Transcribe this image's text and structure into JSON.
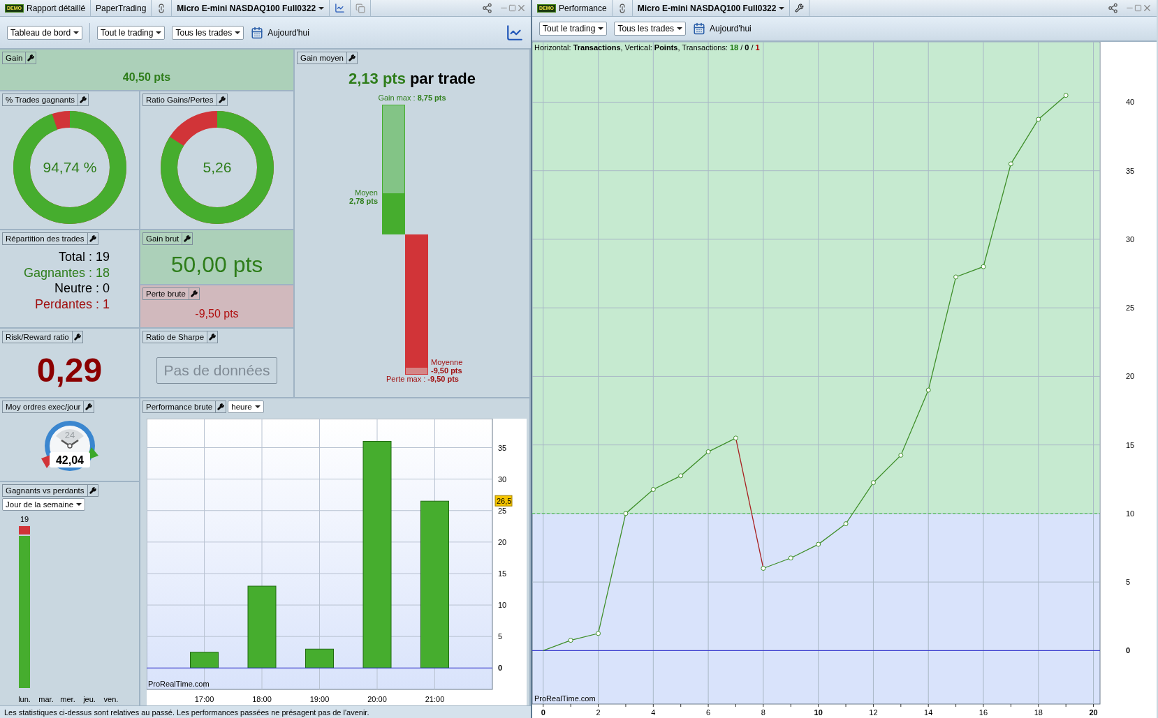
{
  "left_window": {
    "badge": "DEMO",
    "title_segments": [
      "Rapport détaillé",
      "PaperTrading"
    ],
    "instrument": "Micro E-mini NASDAQ100 Full0322",
    "toolbar": {
      "dropdowns": [
        "Tableau de bord",
        "Tout le trading",
        "Tous les trades"
      ],
      "date_button": "Aujourd'hui"
    },
    "gain": {
      "title": "Gain",
      "value": "40,50 pts"
    },
    "winning_trades": {
      "title": "% Trades gagnants",
      "reading": "94,74 %",
      "level": 0.9474
    },
    "gain_loss_ratio": {
      "title": "Ratio Gains/Pertes",
      "reading": "5,26",
      "level": 0.84
    },
    "average_gain": {
      "title": "Gain moyen",
      "value": "2,13 pts",
      "suffix": "par trade",
      "max_gain": "Gain max : **8,75 pts**",
      "average_label": "Moyen",
      "average_value": "2,78 pts",
      "average_loss_label": "Moyenne",
      "average_loss_value": "-9,50 pts",
      "max_loss": "Perte max : **-9,50 pts**"
    },
    "trade_breakdown": {
      "title": "Répartition des trades",
      "lines": [
        {
          "kind": "total",
          "text": "Total : 19"
        },
        {
          "kind": "win",
          "text": "Gagnantes : 18"
        },
        {
          "kind": "neutral",
          "text": "Neutre : 0"
        },
        {
          "kind": "loss",
          "text": "Perdantes : 1"
        }
      ]
    },
    "gross_gain": {
      "title": "Gain brut",
      "value": "50,00 pts"
    },
    "gross_loss": {
      "title": "Perte brute",
      "value": "-9,50 pts"
    },
    "risk_reward": {
      "title": "Risk/Reward ratio",
      "value": "0,29"
    },
    "sharpe": {
      "title": "Ratio de Sharpe",
      "message": "Pas de données"
    },
    "orders_per_day": {
      "title": "Moy ordres exec/jour",
      "dial_label": "24",
      "value": "42,04"
    },
    "winners_vs_losers": {
      "title": "Gagnants vs perdants",
      "period": "Jour de la semaine",
      "total_label": "19",
      "days": [
        "lun.",
        "mar.",
        "mer.",
        "jeu.",
        "ven."
      ]
    },
    "gross_performance": {
      "title": "Performance brute",
      "period": "heure",
      "watermark": "ProRealTime.com",
      "chart_data": {
        "type": "bar",
        "grid": true,
        "categories": [
          "17:00",
          "18:00",
          "19:00",
          "20:00",
          "21:00"
        ],
        "series": [
          {
            "color": "#46ad2e",
            "values": [
              2.5,
              13,
              3,
              36,
              26.5
            ]
          }
        ],
        "ylim": [
          -3.4,
          39.6
        ],
        "yticks": [
          0,
          5,
          10,
          15,
          20,
          25,
          30,
          35
        ],
        "ref_lines": [
          {
            "axis": "y",
            "value": 0,
            "color": "#2a2ad0"
          }
        ],
        "annotations": [
          "26,5"
        ]
      }
    },
    "status_bar": "Les statistiques ci-dessus sont relatives au passé. Les performances passées ne présagent pas de l'avenir."
  },
  "right_window": {
    "badge": "DEMO",
    "title": "Performance",
    "instrument": "Micro E-mini NASDAQ100 Full0322",
    "toolbar": {
      "dropdowns": [
        "Tout le trading",
        "Tous les trades"
      ],
      "date_button": "Aujourd'hui"
    },
    "chart": {
      "legend": "Horizontal: **Transactions**, Vertical: **Points**, Transactions:",
      "counts": [
        {
          "value": "18",
          "color": "#1e7a12"
        },
        {
          "value": "0",
          "color": "#000000"
        },
        {
          "value": "1",
          "color": "#b00000"
        }
      ],
      "separator": "/",
      "watermark": "ProRealTime.com",
      "chart_data": {
        "type": "line",
        "grid": true,
        "x": [
          0,
          1,
          2,
          3,
          4,
          5,
          6,
          7,
          8,
          9,
          10,
          11,
          12,
          13,
          14,
          15,
          16,
          17,
          18,
          19
        ],
        "series": [
          {
            "color": "#3f8f2a",
            "marker": true,
            "values": [
              0,
              0.75,
              1.25,
              10,
              11.75,
              12.75,
              14.5,
              15.5,
              null,
              null,
              null,
              null,
              null,
              null,
              null,
              null,
              null,
              null,
              null,
              null
            ]
          },
          {
            "color": "#a82020",
            "marker": false,
            "values": [
              null,
              null,
              null,
              null,
              null,
              null,
              null,
              15.5,
              6,
              null,
              null,
              null,
              null,
              null,
              null,
              null,
              null,
              null,
              null,
              null
            ]
          },
          {
            "color": "#3f8f2a",
            "marker": true,
            "values": [
              null,
              null,
              null,
              null,
              null,
              null,
              null,
              null,
              6,
              6.75,
              7.75,
              9.25,
              12.25,
              14.25,
              19,
              27.25,
              28,
              35.5,
              38.75,
              40.5
            ]
          }
        ],
        "xlim": [
          -0.4,
          20.24
        ],
        "ylim": [
          -3.9,
          44.4
        ],
        "xticks": [
          0,
          2,
          4,
          6,
          8,
          10,
          12,
          14,
          16,
          18,
          20
        ],
        "yticks": [
          0,
          5,
          10,
          15,
          20,
          25,
          30,
          35,
          40
        ],
        "ref_lines": [
          {
            "axis": "y",
            "value": 10,
            "color": "#3cbf3c"
          },
          {
            "axis": "y",
            "value": 0,
            "color": "#2a2ad0"
          }
        ],
        "bands": [
          {
            "axis": "y",
            "from": 10,
            "to": 44.4,
            "color": "#c6ead0"
          }
        ]
      }
    }
  }
}
